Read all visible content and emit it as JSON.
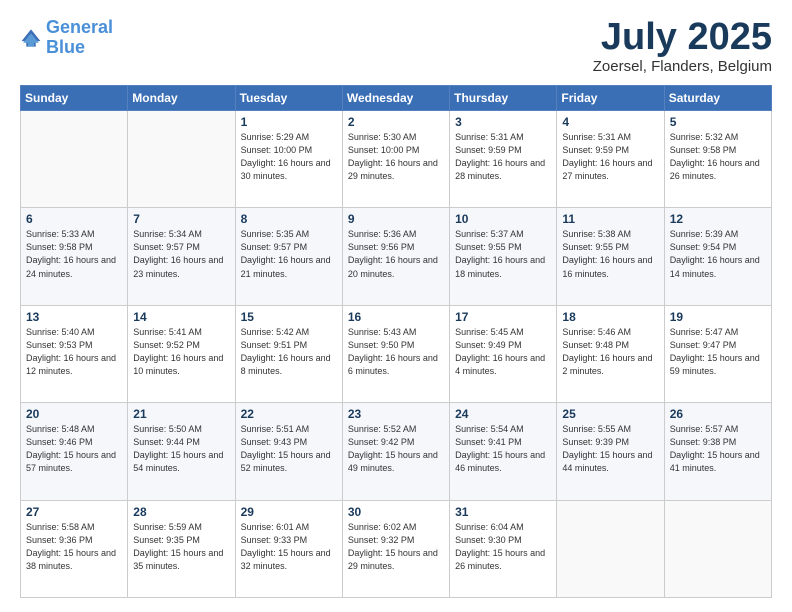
{
  "header": {
    "logo_line1": "General",
    "logo_line2": "Blue",
    "month": "July 2025",
    "location": "Zoersel, Flanders, Belgium"
  },
  "weekdays": [
    "Sunday",
    "Monday",
    "Tuesday",
    "Wednesday",
    "Thursday",
    "Friday",
    "Saturday"
  ],
  "weeks": [
    [
      {
        "day": "",
        "info": ""
      },
      {
        "day": "",
        "info": ""
      },
      {
        "day": "1",
        "info": "Sunrise: 5:29 AM\nSunset: 10:00 PM\nDaylight: 16 hours\nand 30 minutes."
      },
      {
        "day": "2",
        "info": "Sunrise: 5:30 AM\nSunset: 10:00 PM\nDaylight: 16 hours\nand 29 minutes."
      },
      {
        "day": "3",
        "info": "Sunrise: 5:31 AM\nSunset: 9:59 PM\nDaylight: 16 hours\nand 28 minutes."
      },
      {
        "day": "4",
        "info": "Sunrise: 5:31 AM\nSunset: 9:59 PM\nDaylight: 16 hours\nand 27 minutes."
      },
      {
        "day": "5",
        "info": "Sunrise: 5:32 AM\nSunset: 9:58 PM\nDaylight: 16 hours\nand 26 minutes."
      }
    ],
    [
      {
        "day": "6",
        "info": "Sunrise: 5:33 AM\nSunset: 9:58 PM\nDaylight: 16 hours\nand 24 minutes."
      },
      {
        "day": "7",
        "info": "Sunrise: 5:34 AM\nSunset: 9:57 PM\nDaylight: 16 hours\nand 23 minutes."
      },
      {
        "day": "8",
        "info": "Sunrise: 5:35 AM\nSunset: 9:57 PM\nDaylight: 16 hours\nand 21 minutes."
      },
      {
        "day": "9",
        "info": "Sunrise: 5:36 AM\nSunset: 9:56 PM\nDaylight: 16 hours\nand 20 minutes."
      },
      {
        "day": "10",
        "info": "Sunrise: 5:37 AM\nSunset: 9:55 PM\nDaylight: 16 hours\nand 18 minutes."
      },
      {
        "day": "11",
        "info": "Sunrise: 5:38 AM\nSunset: 9:55 PM\nDaylight: 16 hours\nand 16 minutes."
      },
      {
        "day": "12",
        "info": "Sunrise: 5:39 AM\nSunset: 9:54 PM\nDaylight: 16 hours\nand 14 minutes."
      }
    ],
    [
      {
        "day": "13",
        "info": "Sunrise: 5:40 AM\nSunset: 9:53 PM\nDaylight: 16 hours\nand 12 minutes."
      },
      {
        "day": "14",
        "info": "Sunrise: 5:41 AM\nSunset: 9:52 PM\nDaylight: 16 hours\nand 10 minutes."
      },
      {
        "day": "15",
        "info": "Sunrise: 5:42 AM\nSunset: 9:51 PM\nDaylight: 16 hours\nand 8 minutes."
      },
      {
        "day": "16",
        "info": "Sunrise: 5:43 AM\nSunset: 9:50 PM\nDaylight: 16 hours\nand 6 minutes."
      },
      {
        "day": "17",
        "info": "Sunrise: 5:45 AM\nSunset: 9:49 PM\nDaylight: 16 hours\nand 4 minutes."
      },
      {
        "day": "18",
        "info": "Sunrise: 5:46 AM\nSunset: 9:48 PM\nDaylight: 16 hours\nand 2 minutes."
      },
      {
        "day": "19",
        "info": "Sunrise: 5:47 AM\nSunset: 9:47 PM\nDaylight: 15 hours\nand 59 minutes."
      }
    ],
    [
      {
        "day": "20",
        "info": "Sunrise: 5:48 AM\nSunset: 9:46 PM\nDaylight: 15 hours\nand 57 minutes."
      },
      {
        "day": "21",
        "info": "Sunrise: 5:50 AM\nSunset: 9:44 PM\nDaylight: 15 hours\nand 54 minutes."
      },
      {
        "day": "22",
        "info": "Sunrise: 5:51 AM\nSunset: 9:43 PM\nDaylight: 15 hours\nand 52 minutes."
      },
      {
        "day": "23",
        "info": "Sunrise: 5:52 AM\nSunset: 9:42 PM\nDaylight: 15 hours\nand 49 minutes."
      },
      {
        "day": "24",
        "info": "Sunrise: 5:54 AM\nSunset: 9:41 PM\nDaylight: 15 hours\nand 46 minutes."
      },
      {
        "day": "25",
        "info": "Sunrise: 5:55 AM\nSunset: 9:39 PM\nDaylight: 15 hours\nand 44 minutes."
      },
      {
        "day": "26",
        "info": "Sunrise: 5:57 AM\nSunset: 9:38 PM\nDaylight: 15 hours\nand 41 minutes."
      }
    ],
    [
      {
        "day": "27",
        "info": "Sunrise: 5:58 AM\nSunset: 9:36 PM\nDaylight: 15 hours\nand 38 minutes."
      },
      {
        "day": "28",
        "info": "Sunrise: 5:59 AM\nSunset: 9:35 PM\nDaylight: 15 hours\nand 35 minutes."
      },
      {
        "day": "29",
        "info": "Sunrise: 6:01 AM\nSunset: 9:33 PM\nDaylight: 15 hours\nand 32 minutes."
      },
      {
        "day": "30",
        "info": "Sunrise: 6:02 AM\nSunset: 9:32 PM\nDaylight: 15 hours\nand 29 minutes."
      },
      {
        "day": "31",
        "info": "Sunrise: 6:04 AM\nSunset: 9:30 PM\nDaylight: 15 hours\nand 26 minutes."
      },
      {
        "day": "",
        "info": ""
      },
      {
        "day": "",
        "info": ""
      }
    ]
  ]
}
